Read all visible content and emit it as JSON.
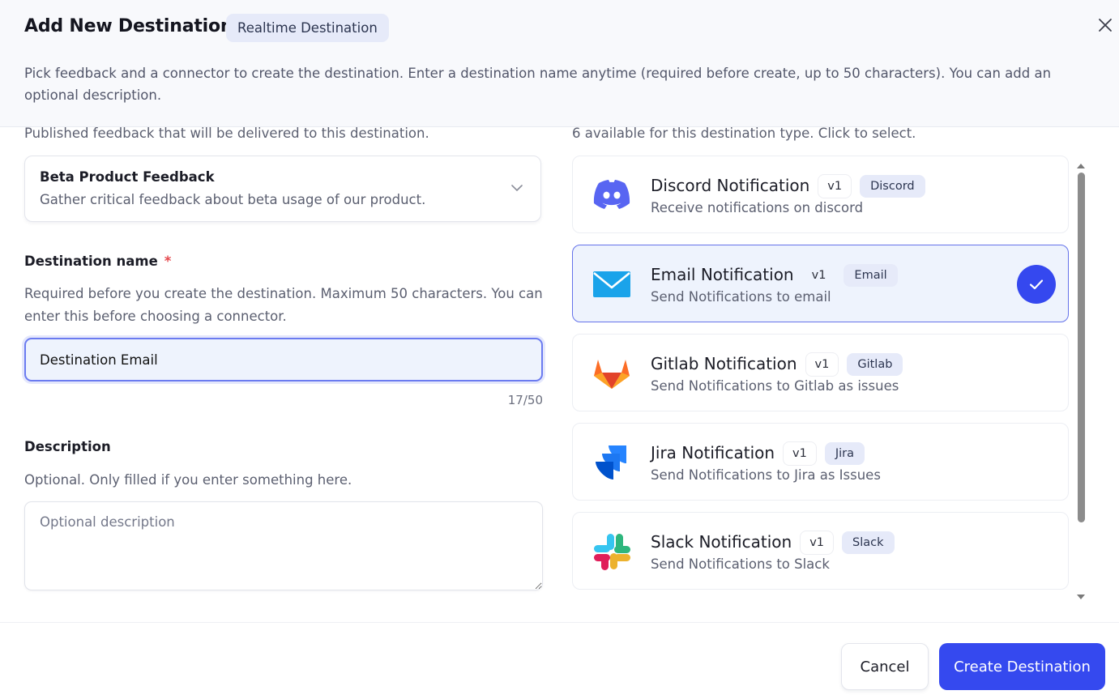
{
  "dialog": {
    "title": "Add New Destination",
    "type_badge": "Realtime Destination",
    "subtitle": "Pick feedback and a connector to create the destination. Enter a destination name anytime (required before create, up to 50 characters). You can add an optional description."
  },
  "feedback": {
    "help": "Published feedback that will be delivered to this destination.",
    "selected_title": "Beta Product Feedback",
    "selected_description": "Gather critical feedback about beta usage of our product."
  },
  "destination_name": {
    "label": "Destination name",
    "required_marker": "*",
    "help": "Required before you create the destination. Maximum 50 characters. You can enter this before choosing a connector.",
    "value": "Destination Email",
    "counter": "17/50"
  },
  "description": {
    "label": "Description",
    "help": "Optional. Only filled if you enter something here.",
    "placeholder": "Optional description"
  },
  "connectors": {
    "help": "6 available for this destination type. Click to select.",
    "items": [
      {
        "name": "Discord Notification",
        "version": "v1",
        "service": "Discord",
        "description": "Receive notifications on discord",
        "icon": "discord-icon",
        "selected": false
      },
      {
        "name": "Email Notification",
        "version": "v1",
        "service": "Email",
        "description": "Send Notifications to email",
        "icon": "email-icon",
        "selected": true
      },
      {
        "name": "Gitlab Notification",
        "version": "v1",
        "service": "Gitlab",
        "description": "Send Notifications to Gitlab as issues",
        "icon": "gitlab-icon",
        "selected": false
      },
      {
        "name": "Jira Notification",
        "version": "v1",
        "service": "Jira",
        "description": "Send Notifications to Jira as Issues",
        "icon": "jira-icon",
        "selected": false
      },
      {
        "name": "Slack Notification",
        "version": "v1",
        "service": "Slack",
        "description": "Send Notifications to Slack",
        "icon": "slack-icon",
        "selected": false
      }
    ]
  },
  "footer": {
    "cancel_label": "Cancel",
    "create_label": "Create Destination"
  },
  "colors": {
    "accent": "#3549ef",
    "selected_bg": "#eef3fd",
    "badge_bg": "#e6eaf9",
    "required": "#e5484d"
  }
}
